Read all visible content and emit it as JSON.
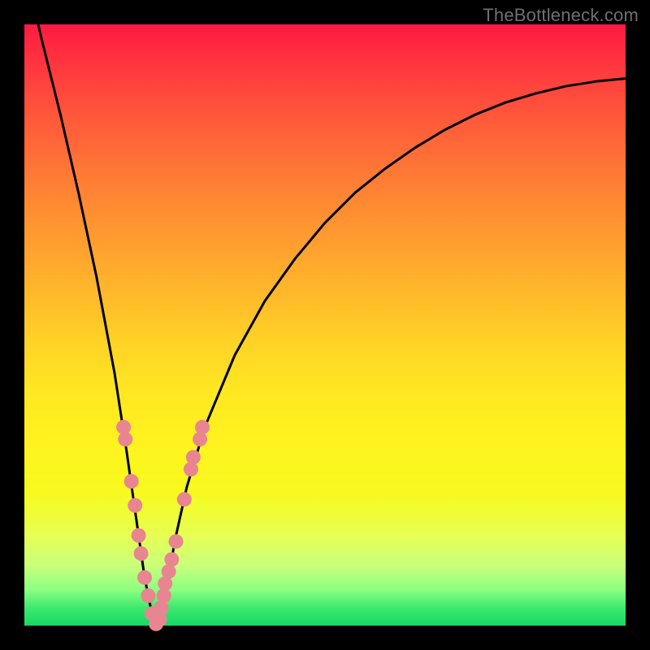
{
  "watermark": "TheBottleneck.com",
  "chart_data": {
    "type": "line",
    "title": "",
    "xlabel": "",
    "ylabel": "",
    "xlim": [
      0,
      100
    ],
    "ylim": [
      0,
      100
    ],
    "grid": false,
    "series": [
      {
        "name": "bottleneck-curve",
        "color": "#000000",
        "x": [
          0,
          3,
          6,
          9,
          12,
          15,
          17,
          18,
          19,
          20,
          21,
          22,
          23,
          24,
          25,
          27,
          30,
          35,
          40,
          45,
          50,
          55,
          60,
          65,
          70,
          75,
          80,
          85,
          90,
          95,
          100
        ],
        "values": [
          110,
          97,
          85,
          72,
          58,
          42,
          29,
          22,
          15,
          8,
          3,
          0,
          3,
          8,
          14,
          23,
          33,
          45,
          54,
          61,
          67,
          72,
          76,
          79.5,
          82.5,
          85,
          87,
          88.5,
          89.7,
          90.5,
          91
        ]
      }
    ],
    "markers": {
      "name": "highlighted-points",
      "color": "#e98591",
      "points": [
        {
          "x": 16.5,
          "y": 33
        },
        {
          "x": 16.8,
          "y": 31
        },
        {
          "x": 17.8,
          "y": 24
        },
        {
          "x": 18.4,
          "y": 20
        },
        {
          "x": 19.0,
          "y": 15
        },
        {
          "x": 19.4,
          "y": 12
        },
        {
          "x": 20.0,
          "y": 8
        },
        {
          "x": 20.6,
          "y": 5
        },
        {
          "x": 21.2,
          "y": 2
        },
        {
          "x": 21.9,
          "y": 0.3
        },
        {
          "x": 22.5,
          "y": 1
        },
        {
          "x": 22.8,
          "y": 3
        },
        {
          "x": 23.2,
          "y": 5
        },
        {
          "x": 23.4,
          "y": 7
        },
        {
          "x": 24.0,
          "y": 9
        },
        {
          "x": 24.5,
          "y": 11
        },
        {
          "x": 25.2,
          "y": 14
        },
        {
          "x": 26.6,
          "y": 21
        },
        {
          "x": 27.7,
          "y": 26
        },
        {
          "x": 28.1,
          "y": 28
        },
        {
          "x": 29.2,
          "y": 31
        },
        {
          "x": 29.6,
          "y": 33
        }
      ]
    }
  }
}
